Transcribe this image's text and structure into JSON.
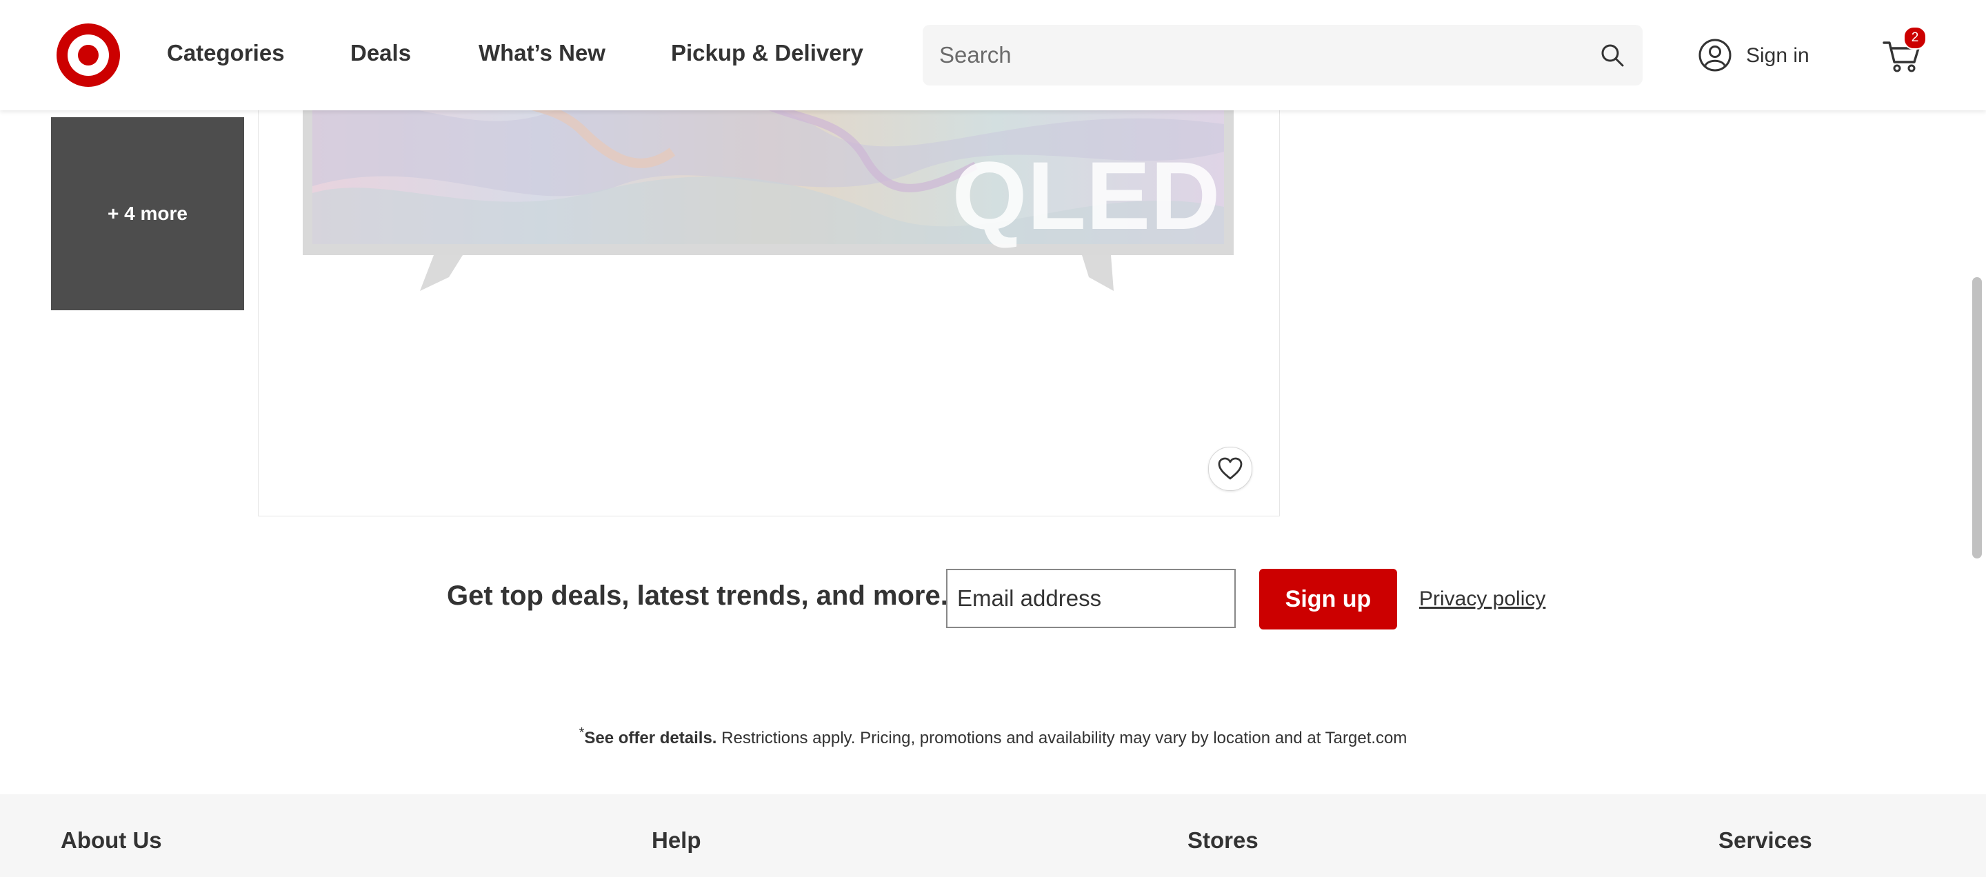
{
  "header": {
    "nav": [
      "Categories",
      "Deals",
      "What’s New",
      "Pickup & Delivery"
    ],
    "search_placeholder": "Search",
    "sign_in_label": "Sign in",
    "cart_count": "2",
    "icons": [
      "target-logo-icon",
      "search-icon",
      "user-icon",
      "cart-icon"
    ]
  },
  "gallery": {
    "more_label": "+ 4 more",
    "image_text": "QLED",
    "icons": [
      "heart-icon"
    ]
  },
  "newsletter": {
    "heading": "Get top deals, latest trends, and more.",
    "email_placeholder": "Email address",
    "signup_label": "Sign up",
    "privacy_label": "Privacy policy"
  },
  "offer": {
    "asterisk": "*",
    "bold": "See offer details.",
    "text": " Restrictions apply. Pricing, promotions and availability may vary by location and at Target.com"
  },
  "footer": {
    "headings": [
      "About Us",
      "Help",
      "Stores",
      "Services"
    ]
  },
  "colors": {
    "brand_red": "#cc0000",
    "text": "#333333",
    "footer_bg": "#f6f6f6",
    "thumb_bg": "#4d4d4d"
  }
}
